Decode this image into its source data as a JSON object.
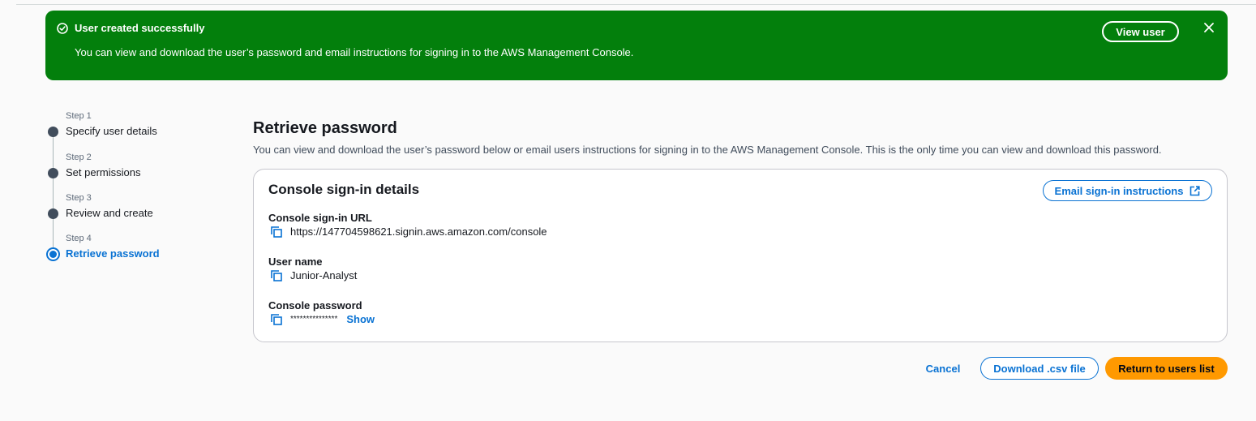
{
  "flash": {
    "title": "User created successfully",
    "message": "You can view and download the user’s password and email instructions for signing in to the AWS Management Console.",
    "view_user_label": "View user",
    "color": "#037f0c"
  },
  "steps": [
    {
      "number": "Step 1",
      "label": "Specify user details"
    },
    {
      "number": "Step 2",
      "label": "Set permissions"
    },
    {
      "number": "Step 3",
      "label": "Review and create"
    },
    {
      "number": "Step 4",
      "label": "Retrieve password",
      "active": true
    }
  ],
  "main": {
    "title": "Retrieve password",
    "description": "You can view and download the user’s password below or email users instructions for signing in to the AWS Management Console. This is the only time you can view and download this password."
  },
  "panel": {
    "title": "Console sign-in details",
    "email_button_label": "Email sign-in instructions",
    "fields": [
      {
        "label": "Console sign-in URL",
        "value": "https://147704598621.signin.aws.amazon.com/console"
      },
      {
        "label": "User name",
        "value": "Junior-Analyst"
      },
      {
        "label": "Console password",
        "value": "***************",
        "show_label": "Show"
      }
    ]
  },
  "footer": {
    "cancel_label": "Cancel",
    "download_label": "Download .csv file",
    "return_label": "Return to users list"
  },
  "colors": {
    "accent": "#0972d3",
    "primary_button": "#ff9900"
  }
}
